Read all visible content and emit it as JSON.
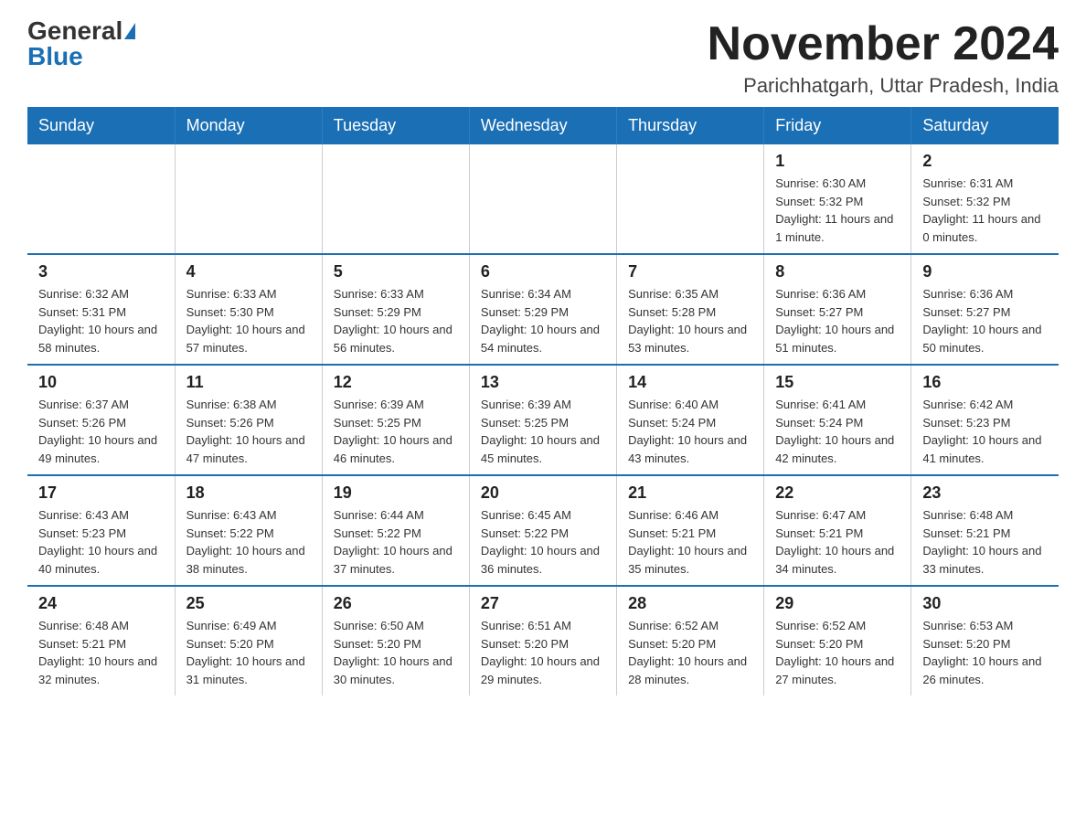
{
  "logo": {
    "general": "General",
    "blue": "Blue"
  },
  "title": "November 2024",
  "subtitle": "Parichhatgarh, Uttar Pradesh, India",
  "headers": [
    "Sunday",
    "Monday",
    "Tuesday",
    "Wednesday",
    "Thursday",
    "Friday",
    "Saturday"
  ],
  "weeks": [
    [
      {
        "day": "",
        "info": ""
      },
      {
        "day": "",
        "info": ""
      },
      {
        "day": "",
        "info": ""
      },
      {
        "day": "",
        "info": ""
      },
      {
        "day": "",
        "info": ""
      },
      {
        "day": "1",
        "info": "Sunrise: 6:30 AM\nSunset: 5:32 PM\nDaylight: 11 hours and 1 minute."
      },
      {
        "day": "2",
        "info": "Sunrise: 6:31 AM\nSunset: 5:32 PM\nDaylight: 11 hours and 0 minutes."
      }
    ],
    [
      {
        "day": "3",
        "info": "Sunrise: 6:32 AM\nSunset: 5:31 PM\nDaylight: 10 hours and 58 minutes."
      },
      {
        "day": "4",
        "info": "Sunrise: 6:33 AM\nSunset: 5:30 PM\nDaylight: 10 hours and 57 minutes."
      },
      {
        "day": "5",
        "info": "Sunrise: 6:33 AM\nSunset: 5:29 PM\nDaylight: 10 hours and 56 minutes."
      },
      {
        "day": "6",
        "info": "Sunrise: 6:34 AM\nSunset: 5:29 PM\nDaylight: 10 hours and 54 minutes."
      },
      {
        "day": "7",
        "info": "Sunrise: 6:35 AM\nSunset: 5:28 PM\nDaylight: 10 hours and 53 minutes."
      },
      {
        "day": "8",
        "info": "Sunrise: 6:36 AM\nSunset: 5:27 PM\nDaylight: 10 hours and 51 minutes."
      },
      {
        "day": "9",
        "info": "Sunrise: 6:36 AM\nSunset: 5:27 PM\nDaylight: 10 hours and 50 minutes."
      }
    ],
    [
      {
        "day": "10",
        "info": "Sunrise: 6:37 AM\nSunset: 5:26 PM\nDaylight: 10 hours and 49 minutes."
      },
      {
        "day": "11",
        "info": "Sunrise: 6:38 AM\nSunset: 5:26 PM\nDaylight: 10 hours and 47 minutes."
      },
      {
        "day": "12",
        "info": "Sunrise: 6:39 AM\nSunset: 5:25 PM\nDaylight: 10 hours and 46 minutes."
      },
      {
        "day": "13",
        "info": "Sunrise: 6:39 AM\nSunset: 5:25 PM\nDaylight: 10 hours and 45 minutes."
      },
      {
        "day": "14",
        "info": "Sunrise: 6:40 AM\nSunset: 5:24 PM\nDaylight: 10 hours and 43 minutes."
      },
      {
        "day": "15",
        "info": "Sunrise: 6:41 AM\nSunset: 5:24 PM\nDaylight: 10 hours and 42 minutes."
      },
      {
        "day": "16",
        "info": "Sunrise: 6:42 AM\nSunset: 5:23 PM\nDaylight: 10 hours and 41 minutes."
      }
    ],
    [
      {
        "day": "17",
        "info": "Sunrise: 6:43 AM\nSunset: 5:23 PM\nDaylight: 10 hours and 40 minutes."
      },
      {
        "day": "18",
        "info": "Sunrise: 6:43 AM\nSunset: 5:22 PM\nDaylight: 10 hours and 38 minutes."
      },
      {
        "day": "19",
        "info": "Sunrise: 6:44 AM\nSunset: 5:22 PM\nDaylight: 10 hours and 37 minutes."
      },
      {
        "day": "20",
        "info": "Sunrise: 6:45 AM\nSunset: 5:22 PM\nDaylight: 10 hours and 36 minutes."
      },
      {
        "day": "21",
        "info": "Sunrise: 6:46 AM\nSunset: 5:21 PM\nDaylight: 10 hours and 35 minutes."
      },
      {
        "day": "22",
        "info": "Sunrise: 6:47 AM\nSunset: 5:21 PM\nDaylight: 10 hours and 34 minutes."
      },
      {
        "day": "23",
        "info": "Sunrise: 6:48 AM\nSunset: 5:21 PM\nDaylight: 10 hours and 33 minutes."
      }
    ],
    [
      {
        "day": "24",
        "info": "Sunrise: 6:48 AM\nSunset: 5:21 PM\nDaylight: 10 hours and 32 minutes."
      },
      {
        "day": "25",
        "info": "Sunrise: 6:49 AM\nSunset: 5:20 PM\nDaylight: 10 hours and 31 minutes."
      },
      {
        "day": "26",
        "info": "Sunrise: 6:50 AM\nSunset: 5:20 PM\nDaylight: 10 hours and 30 minutes."
      },
      {
        "day": "27",
        "info": "Sunrise: 6:51 AM\nSunset: 5:20 PM\nDaylight: 10 hours and 29 minutes."
      },
      {
        "day": "28",
        "info": "Sunrise: 6:52 AM\nSunset: 5:20 PM\nDaylight: 10 hours and 28 minutes."
      },
      {
        "day": "29",
        "info": "Sunrise: 6:52 AM\nSunset: 5:20 PM\nDaylight: 10 hours and 27 minutes."
      },
      {
        "day": "30",
        "info": "Sunrise: 6:53 AM\nSunset: 5:20 PM\nDaylight: 10 hours and 26 minutes."
      }
    ]
  ]
}
